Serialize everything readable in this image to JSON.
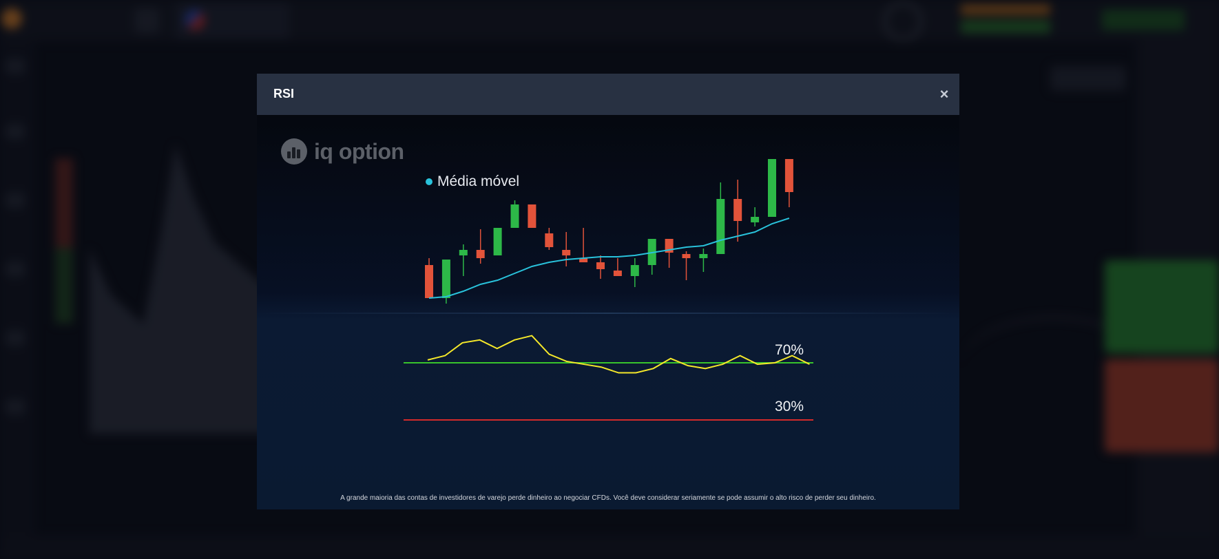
{
  "modal": {
    "title": "RSI",
    "close_label": "×",
    "logo_text": "iq option",
    "legend_label": "Média móvel",
    "disclaimer": "A grande maioria das contas de investidores de varejo perde dinheiro ao negociar CFDs. Você deve considerar seriamente se pode assumir o alto risco de perder seu dinheiro."
  },
  "colors": {
    "bullish": "#2db848",
    "bearish": "#e2533a",
    "moving_average": "#29c2db",
    "rsi_line": "#f5e82a",
    "overbought_line": "#38c42c",
    "oversold_line": "#d42a2a"
  },
  "chart_data": [
    {
      "type": "candlestick",
      "title": "",
      "series": [
        {
          "name": "Média móvel"
        }
      ],
      "candles": [
        {
          "direction": "down",
          "open": 62,
          "close": 14,
          "high": 72,
          "low": 14
        },
        {
          "direction": "up",
          "open": 14,
          "close": 70,
          "high": 70,
          "low": 6
        },
        {
          "direction": "up",
          "open": 76,
          "close": 84,
          "high": 92,
          "low": 46
        },
        {
          "direction": "down",
          "open": 84,
          "close": 72,
          "high": 114,
          "low": 64
        },
        {
          "direction": "up",
          "open": 76,
          "close": 116,
          "high": 116,
          "low": 76
        },
        {
          "direction": "up",
          "open": 116,
          "close": 150,
          "high": 156,
          "low": 116
        },
        {
          "direction": "down",
          "open": 150,
          "close": 116,
          "high": 150,
          "low": 116
        },
        {
          "direction": "down",
          "open": 108,
          "close": 88,
          "high": 116,
          "low": 84
        },
        {
          "direction": "down",
          "open": 84,
          "close": 76,
          "high": 110,
          "low": 60
        },
        {
          "direction": "down",
          "open": 72,
          "close": 66,
          "high": 116,
          "low": 66
        },
        {
          "direction": "down",
          "open": 66,
          "close": 56,
          "high": 76,
          "low": 42
        },
        {
          "direction": "down",
          "open": 54,
          "close": 46,
          "high": 72,
          "low": 46
        },
        {
          "direction": "up",
          "open": 46,
          "close": 62,
          "high": 72,
          "low": 30
        },
        {
          "direction": "up",
          "open": 62,
          "close": 100,
          "high": 100,
          "low": 48
        },
        {
          "direction": "down",
          "open": 100,
          "close": 80,
          "high": 100,
          "low": 58
        },
        {
          "direction": "down",
          "open": 78,
          "close": 72,
          "high": 82,
          "low": 40
        },
        {
          "direction": "up",
          "open": 72,
          "close": 78,
          "high": 86,
          "low": 52
        },
        {
          "direction": "up",
          "open": 78,
          "close": 158,
          "high": 182,
          "low": 78
        },
        {
          "direction": "down",
          "open": 158,
          "close": 126,
          "high": 186,
          "low": 96
        },
        {
          "direction": "up",
          "open": 124,
          "close": 132,
          "high": 146,
          "low": 118
        },
        {
          "direction": "up",
          "open": 132,
          "close": 216,
          "high": 216,
          "low": 132
        },
        {
          "direction": "down",
          "open": 216,
          "close": 168,
          "high": 216,
          "low": 146
        }
      ],
      "moving_average": [
        0,
        2,
        10,
        20,
        26,
        36,
        46,
        52,
        56,
        58,
        60,
        60,
        62,
        66,
        70,
        74,
        76,
        84,
        90,
        96,
        108,
        116
      ]
    },
    {
      "type": "line",
      "title": "",
      "series": [
        {
          "name": "RSI",
          "values": [
            72,
            75,
            84,
            86,
            80,
            86,
            89,
            76,
            71,
            69,
            67,
            63,
            63,
            66,
            73,
            68,
            66,
            69,
            75,
            69,
            70,
            75,
            69
          ]
        }
      ],
      "ylim": [
        0,
        100
      ],
      "levels": [
        {
          "value": 70,
          "label": "70%"
        },
        {
          "value": 30,
          "label": "30%"
        }
      ]
    }
  ]
}
